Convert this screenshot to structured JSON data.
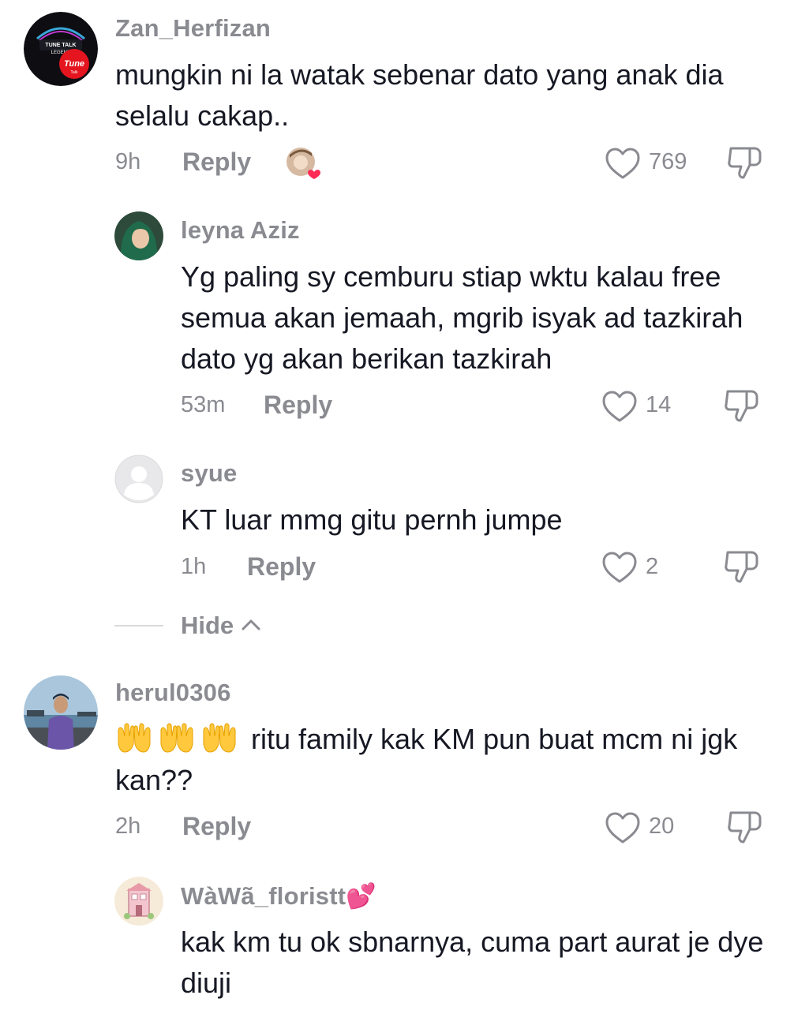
{
  "comments": [
    {
      "username": "Zan_Herfizan",
      "avatar_icon": "tune-talk-logo-avatar",
      "avatar_texts": [
        "TUNE TALK",
        "LEGEND",
        "Tune",
        "Talk"
      ],
      "text": "mungkin ni la watak sebenar dato yang anak dia selalu cakap..",
      "time": "9h",
      "reply_label": "Reply",
      "likes": "769",
      "liked_by_creator": true
    },
    {
      "username": "leyna Aziz",
      "avatar_icon": "woman-hijab-avatar",
      "text": "Yg paling sy cemburu stiap wktu kalau free semua akan jemaah, mgrib isyak ad tazkirah dato yg akan berikan tazkirah",
      "time": "53m",
      "reply_label": "Reply",
      "likes": "14"
    },
    {
      "username": "syue",
      "avatar_icon": "default-user-avatar",
      "text": "KT luar mmg gitu pernh jumpe",
      "time": "1h",
      "reply_label": "Reply",
      "likes": "2"
    },
    {
      "username": "herul0306",
      "avatar_icon": "man-seaside-avatar",
      "emoji": "🤲🤲🤲",
      "text": "ritu family kak KM pun buat mcm ni jgk kan??",
      "time": "2h",
      "reply_label": "Reply",
      "likes": "20"
    },
    {
      "username": "WàWã_floristt💕",
      "avatar_icon": "flower-shop-avatar",
      "text": "kak km tu ok sbnarnya, cuma part aurat je dye diuji"
    }
  ],
  "hide_replies": {
    "label": "Hide"
  },
  "colors": {
    "secondary_text": "#8a8b91",
    "primary_text": "#161823",
    "heart_badge": "#fe2c55"
  }
}
